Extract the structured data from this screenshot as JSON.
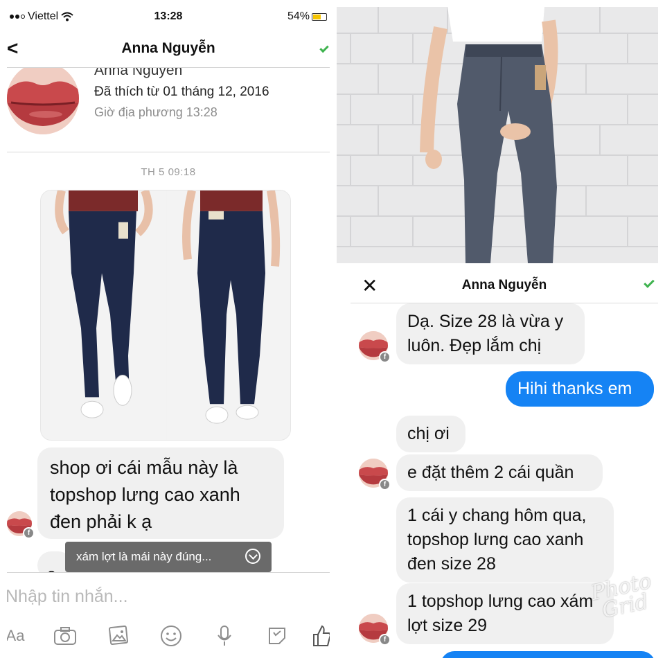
{
  "left": {
    "status": {
      "carrier": "Viettel",
      "time": "13:28",
      "battery": "54%",
      "battery_level": 0.54
    },
    "nav": {
      "back": "<",
      "title": "Anna Nguyễn"
    },
    "profile": {
      "name_cut": "Anna Nguyễn",
      "liked": "Đã thích từ 01 tháng 12, 2016",
      "local_time": "Giờ địa phương 13:28"
    },
    "daystamp": "TH 5 09:18",
    "message_1": [
      "shop ơi cái mẫu này là",
      "topshop lưng cao xanh",
      "đen phải k ạ"
    ],
    "message_2_partial": "c",
    "toast": "xám lợt là mái này đúng...",
    "composer": {
      "placeholder": "Nhập tin nhắn...",
      "tools": [
        "Aa",
        "camera-icon",
        "gallery-icon",
        "emoji-icon",
        "mic-icon",
        "sticker-icon",
        "like-icon"
      ]
    },
    "fb_badge": "f"
  },
  "right": {
    "nav": {
      "close": "✕",
      "title": "Anna Nguyễn"
    },
    "messages": [
      {
        "dir": "in",
        "lines": [
          "Dạ. Size 28 là vừa y",
          "luôn. Đẹp lắm chị"
        ]
      },
      {
        "dir": "out",
        "lines": [
          "Hihi thanks em"
        ]
      },
      {
        "dir": "in",
        "lines": [
          "chị ơi"
        ]
      },
      {
        "dir": "in",
        "lines": [
          "e đặt thêm 2 cái quần"
        ]
      },
      {
        "dir": "in",
        "lines": [
          "1 cái y chang hôm qua,",
          "topshop lưng cao xanh",
          "đen size 28"
        ]
      },
      {
        "dir": "in",
        "lines": [
          "1 topshop lưng cao xám",
          "lợt size 29"
        ]
      }
    ],
    "watermark": [
      "Photo",
      "Grid"
    ],
    "fb_badge": "f"
  },
  "colors": {
    "accent": "#1583f4",
    "check": "#3fb34f",
    "bubble": "#f0f0f0"
  }
}
